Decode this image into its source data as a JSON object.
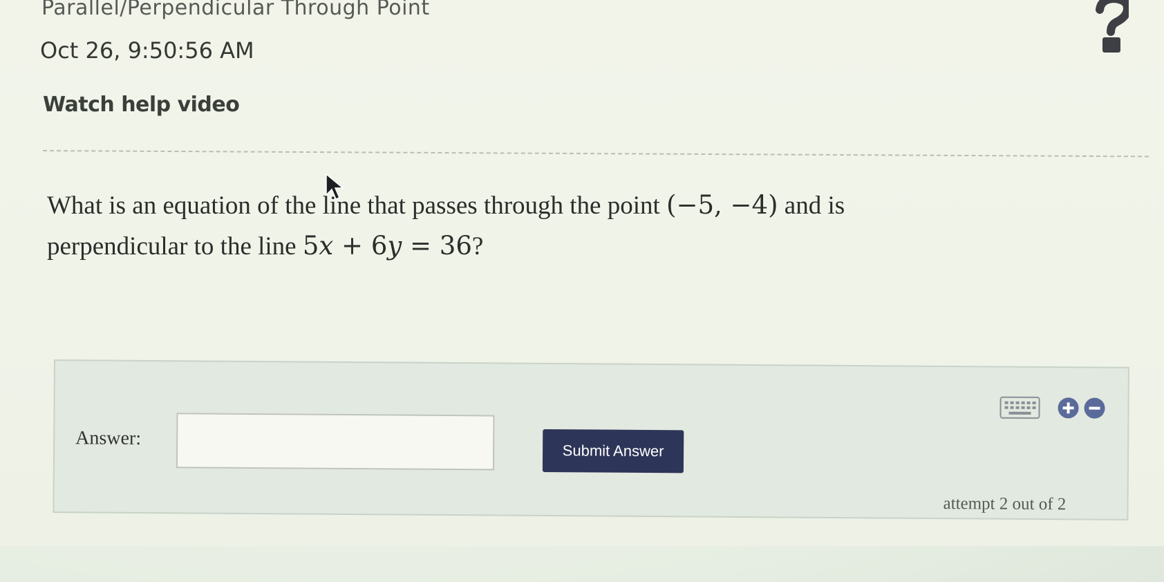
{
  "header": {
    "topic_title": "Parallel/Perpendicular Through Point",
    "timestamp": "Oct 26, 9:50:56 AM",
    "help_link": "Watch help video"
  },
  "question": {
    "line1_prefix": "What is an equation of the line that passes through the point ",
    "point": "(−5, −4)",
    "line1_suffix": " and is",
    "line2_prefix": "perpendicular to the line ",
    "equation_lhs_coef1": "5",
    "equation_var1": "x",
    "equation_op": " + ",
    "equation_coef2": "6",
    "equation_var2": "y",
    "equation_rhs": " = 36",
    "line2_suffix": "?"
  },
  "answer": {
    "label": "Answer:",
    "input_value": "",
    "submit_label": "Submit Answer",
    "attempt_text": "attempt 2 out of 2"
  },
  "icons": {
    "help": "question-mark-icon",
    "keyboard": "keyboard-icon",
    "plus": "plus-circle-icon",
    "minus": "minus-circle-icon",
    "cursor": "mouse-cursor-icon"
  },
  "colors": {
    "submit_button": "#2d3558",
    "icon_blue": "#5a6a9a"
  }
}
